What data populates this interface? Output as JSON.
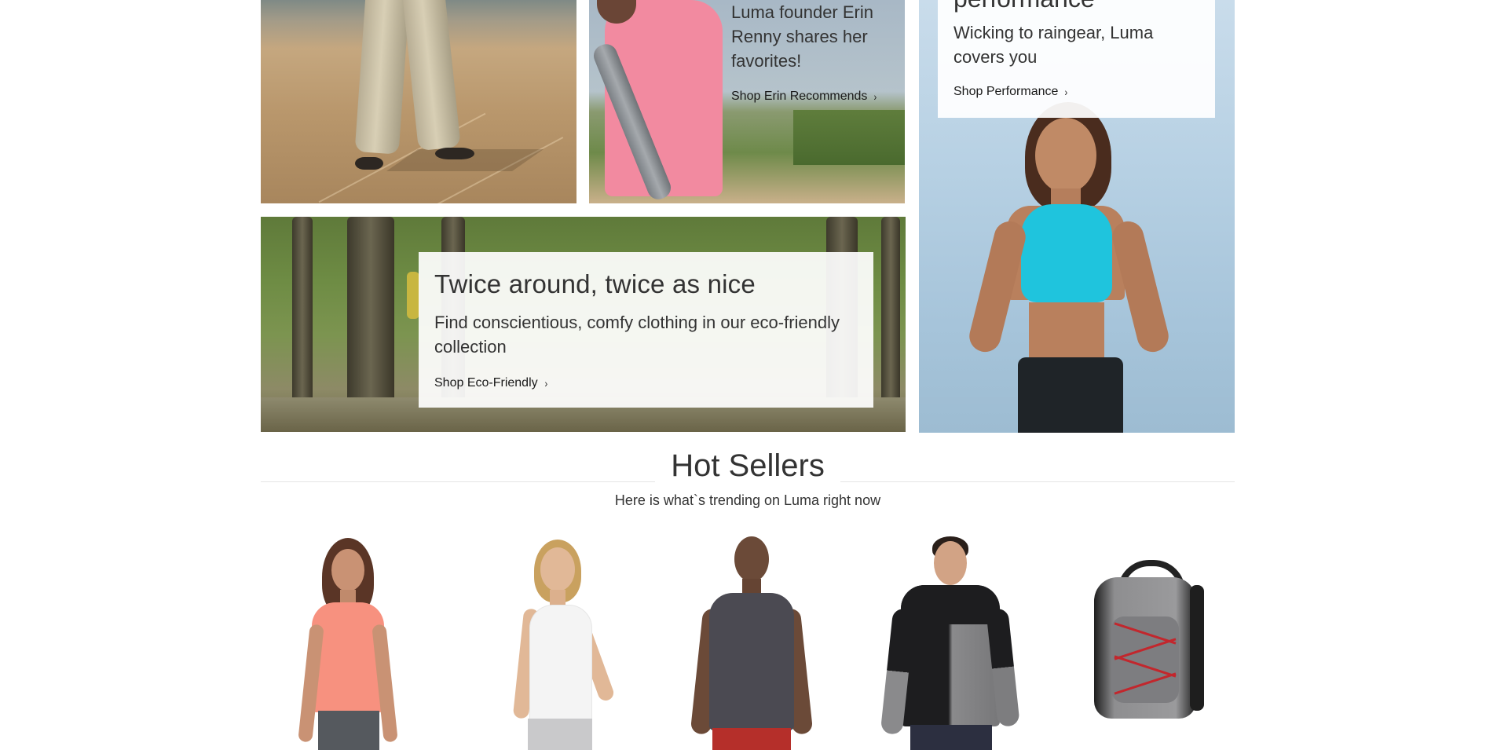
{
  "promos": {
    "erin": {
      "subtitle": "Luma founder Erin Renny shares her favorites!",
      "link": "Shop Erin Recommends"
    },
    "performance": {
      "title_partial": "performance",
      "subtitle": "Wicking to raingear, Luma covers you",
      "link": "Shop Performance"
    },
    "eco": {
      "title": "Twice around, twice as nice",
      "subtitle": "Find conscientious, comfy clothing in our eco-friendly collection",
      "link": "Shop Eco-Friendly"
    }
  },
  "hot_sellers": {
    "title": "Hot Sellers",
    "subtitle": "Here is what`s trending on Luma right now"
  },
  "icons": {
    "link_chevron": "chevron-right-icon",
    "chevron_glyph": "›"
  },
  "colors": {
    "text": "#333333",
    "card_bg": "#ffffff"
  }
}
